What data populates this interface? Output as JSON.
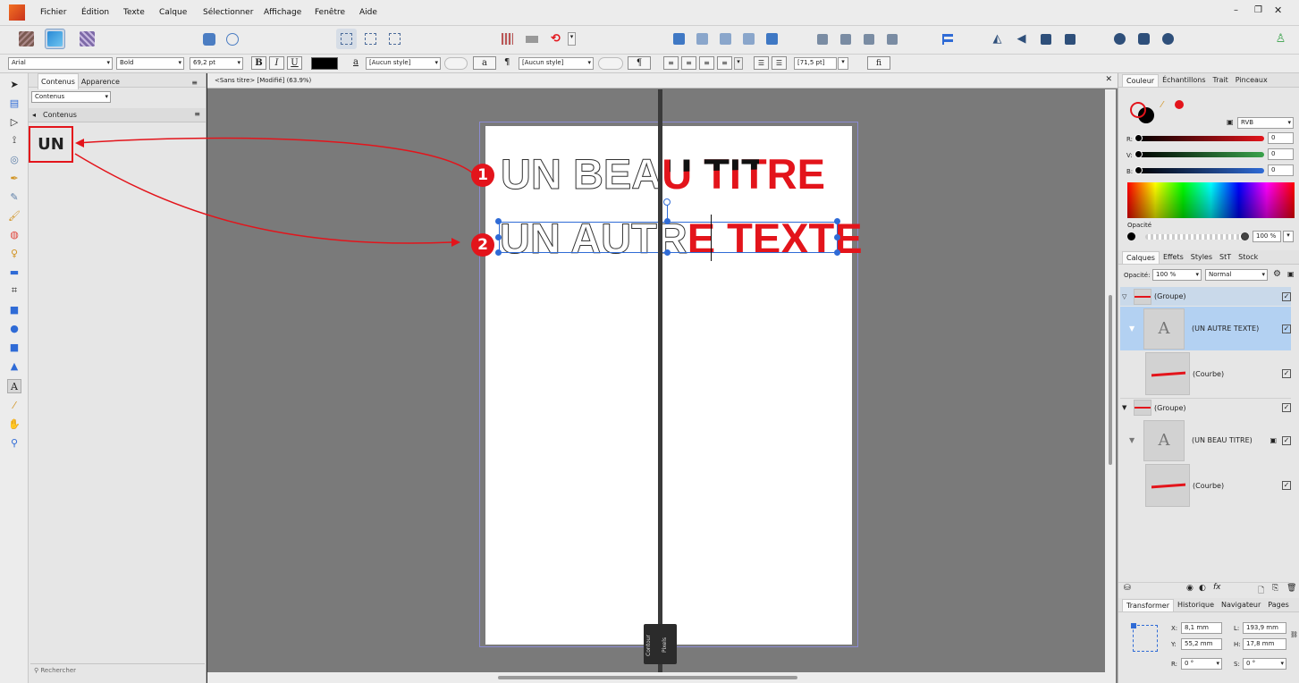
{
  "menu": {
    "items": [
      "Fichier",
      "Édition",
      "Texte",
      "Calque",
      "Sélectionner",
      "Affichage",
      "Fenêtre",
      "Aide"
    ]
  },
  "context_toolbar": {
    "font_family": "Arial",
    "font_style": "Bold",
    "font_size": "69,2 pt",
    "bold": "B",
    "italic": "I",
    "underline": "U",
    "char_style_icon": "a",
    "char_style": "[Aucun style]",
    "char_a": "a",
    "pilcrow": "¶",
    "para_style": "[Aucun style]",
    "para_btn": "¶",
    "leading": "[71,5 pt]",
    "ligature": "fi"
  },
  "left_panel": {
    "tabs": [
      "Contenus",
      "Apparence"
    ],
    "dropdown": "Contenus",
    "section": "Contenus",
    "content_text": "UN",
    "search_placeholder": "Rechercher"
  },
  "document": {
    "tab_title": "<Sans titre> [Modifié] (63.9%)",
    "line1_outline": "UN BEA",
    "line1_filled": "U TITRE",
    "line2_outline": "UN AUTR",
    "line2_filled": "E TEXTE",
    "callout1": "1",
    "callout2": "2",
    "split_label_left": "Contour",
    "split_label_right": "Pixels"
  },
  "color_panel": {
    "tabs": [
      "Couleur",
      "Échantillons",
      "Trait",
      "Pinceaux"
    ],
    "mode": "RVB",
    "r_label": "R:",
    "g_label": "V:",
    "b_label": "B:",
    "r_value": "0",
    "g_value": "0",
    "b_value": "0",
    "opacity_label": "Opacité",
    "opacity_value": "100 %"
  },
  "layers_panel": {
    "tabs": [
      "Calques",
      "Effets",
      "Styles",
      "StT",
      "Stock"
    ],
    "opacity_label": "Opacité:",
    "opacity_value": "100 %",
    "blend_mode": "Normal",
    "layers": [
      {
        "label": "(Groupe)",
        "thumb": "group"
      },
      {
        "label": "(UN AUTRE TEXTE)",
        "thumb": "A"
      },
      {
        "label": "(Courbe)",
        "thumb": "curve"
      },
      {
        "label": "(Groupe)",
        "thumb": "group"
      },
      {
        "label": "(UN BEAU TITRE)",
        "thumb": "A"
      },
      {
        "label": "(Courbe)",
        "thumb": "curve"
      }
    ],
    "fx": "fx"
  },
  "transform_panel": {
    "tabs": [
      "Transformer",
      "Historique",
      "Navigateur",
      "Pages"
    ],
    "x_label": "X:",
    "x_value": "8,1 mm",
    "y_label": "Y:",
    "y_value": "55,2 mm",
    "w_label": "L:",
    "w_value": "193,9 mm",
    "h_label": "H:",
    "h_value": "17,8 mm",
    "r_label": "R:",
    "r_value": "0 °",
    "s_label": "S:",
    "s_value": "0 °"
  },
  "colors": {
    "accent_red": "#e3141b",
    "selection_blue": "#2f6bd6",
    "layer_selected": "#b3d1f2"
  }
}
